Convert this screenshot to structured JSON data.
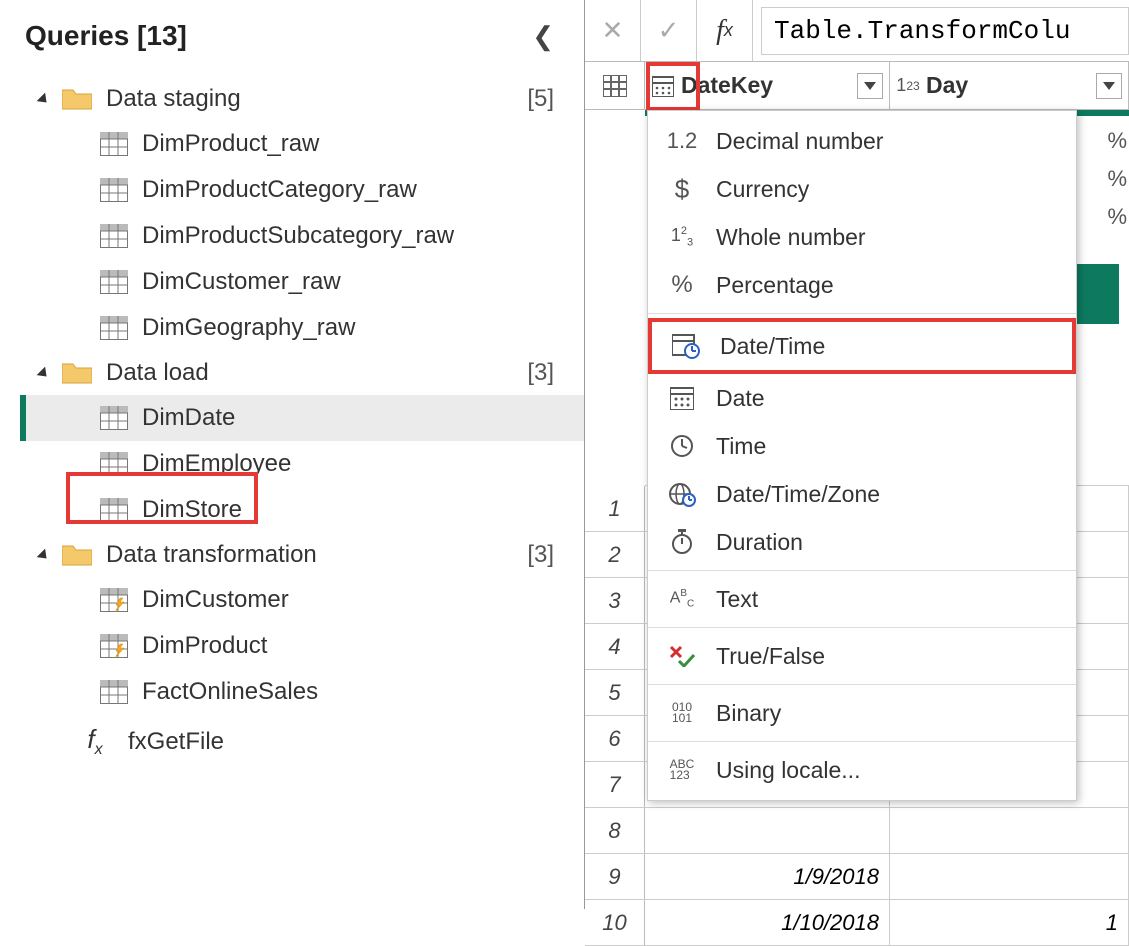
{
  "panel": {
    "title": "Queries [13]"
  },
  "folders": [
    {
      "name": "Data staging",
      "count": "[5]",
      "items": [
        "DimProduct_raw",
        "DimProductCategory_raw",
        "DimProductSubcategory_raw",
        "DimCustomer_raw",
        "DimGeography_raw"
      ]
    },
    {
      "name": "Data load",
      "count": "[3]",
      "items": [
        "DimDate",
        "DimEmployee",
        "DimStore"
      ],
      "selected": "DimDate"
    },
    {
      "name": "Data transformation",
      "count": "[3]",
      "items": [
        "DimCustomer",
        "DimProduct",
        "FactOnlineSales"
      ],
      "lightning": [
        true,
        true,
        false
      ]
    }
  ],
  "fxQuery": "fxGetFile",
  "formulaBar": {
    "text": "Table.TransformColu"
  },
  "columns": [
    {
      "name": "DateKey",
      "typeIcon": "date"
    },
    {
      "name": "Day",
      "typeIcon": "whole"
    }
  ],
  "statsRight": [
    "%",
    "%",
    "%"
  ],
  "visibleRows": [
    {
      "n": "1"
    },
    {
      "n": "2"
    },
    {
      "n": "3"
    },
    {
      "n": "4"
    },
    {
      "n": "5"
    },
    {
      "n": "6"
    },
    {
      "n": "7"
    },
    {
      "n": "8"
    },
    {
      "n": "9",
      "c1": "1/9/2018"
    },
    {
      "n": "10",
      "c1": "1/10/2018",
      "c2": "1"
    }
  ],
  "truncatedLabel": "..",
  "typeMenu": [
    {
      "label": "Decimal number",
      "icon": "1.2"
    },
    {
      "label": "Currency",
      "icon": "$"
    },
    {
      "label": "Whole number",
      "icon": "123"
    },
    {
      "label": "Percentage",
      "icon": "%"
    },
    {
      "sep": true
    },
    {
      "label": "Date/Time",
      "icon": "datetime",
      "highlight": true
    },
    {
      "label": "Date",
      "icon": "date"
    },
    {
      "label": "Time",
      "icon": "time"
    },
    {
      "label": "Date/Time/Zone",
      "icon": "dtz"
    },
    {
      "label": "Duration",
      "icon": "duration"
    },
    {
      "sep": true
    },
    {
      "label": "Text",
      "icon": "abc"
    },
    {
      "sep": true
    },
    {
      "label": "True/False",
      "icon": "tf"
    },
    {
      "sep": true
    },
    {
      "label": "Binary",
      "icon": "bin"
    },
    {
      "sep": true
    },
    {
      "label": "Using locale...",
      "icon": "abc123"
    }
  ]
}
